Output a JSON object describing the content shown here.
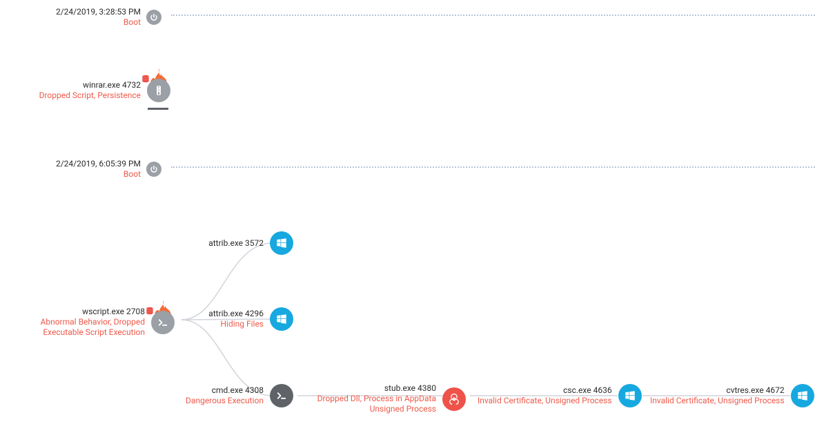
{
  "colors": {
    "accent_red": "#ee5a4a",
    "node_gray": "#9aa0a6",
    "node_gray_dark": "#5f6368",
    "node_blue": "#17a8e0",
    "node_red": "#ee5249",
    "dot": "#b8c4d9"
  },
  "timeline": [
    {
      "timestamp": "2/24/2019, 3:28:53 PM",
      "label": "Boot",
      "icon": "power-icon"
    },
    {
      "timestamp": "2/24/2019, 6:05:39 PM",
      "label": "Boot",
      "icon": "power-icon"
    }
  ],
  "nodes": {
    "winrar": {
      "title": "winrar.exe 4732",
      "sub": "Dropped Script, Persistence",
      "icon": "archive-icon",
      "threat": true
    },
    "wscript": {
      "title": "wscript.exe 2708",
      "sub": "Abnormal Behavior, Dropped Executable Script Execution",
      "icon": "terminal-icon",
      "threat": true
    },
    "attrib1": {
      "title": "attrib.exe 3572",
      "sub": "",
      "icon": "windows-icon"
    },
    "attrib2": {
      "title": "attrib.exe 4296",
      "sub": "Hiding Files",
      "icon": "windows-icon"
    },
    "cmd": {
      "title": "cmd.exe 4308",
      "sub": "Dangerous Execution",
      "icon": "terminal-icon"
    },
    "stub": {
      "title": "stub.exe 4380",
      "sub": "Dropped Dll, Process in AppData Unsigned Process",
      "icon": "biohazard-icon"
    },
    "csc": {
      "title": "csc.exe 4636",
      "sub": "Invalid Certificate, Unsigned Process",
      "icon": "windows-icon"
    },
    "cvtres": {
      "title": "cvtres.exe 4672",
      "sub": "Invalid Certificate, Unsigned Process",
      "icon": "windows-icon"
    }
  },
  "edges": [
    {
      "from": "wscript",
      "to": "attrib1"
    },
    {
      "from": "wscript",
      "to": "attrib2"
    },
    {
      "from": "wscript",
      "to": "cmd"
    },
    {
      "from": "cmd",
      "to": "stub"
    },
    {
      "from": "stub",
      "to": "csc"
    },
    {
      "from": "csc",
      "to": "cvtres"
    }
  ]
}
